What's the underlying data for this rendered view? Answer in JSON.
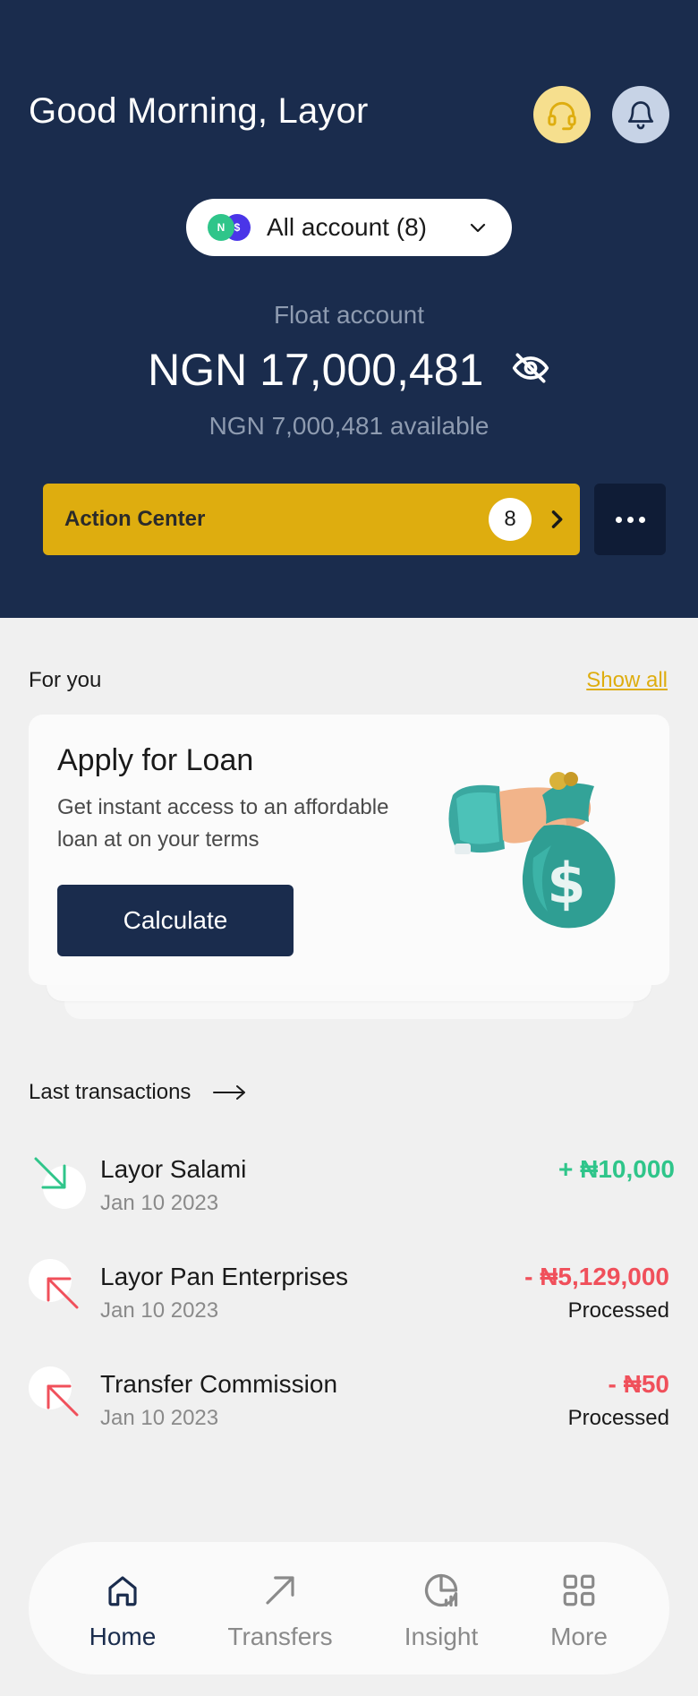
{
  "header": {
    "greeting": "Good Morning, Layor",
    "support_icon": "headset-icon",
    "notification_icon": "bell-icon"
  },
  "account_selector": {
    "label": "All account (8)",
    "flag_1": "N",
    "flag_2": "$"
  },
  "balance": {
    "label": "Float account",
    "amount": "NGN 17,000,481",
    "available": "NGN 7,000,481 available"
  },
  "action_center": {
    "label": "Action Center",
    "count": "8"
  },
  "for_you": {
    "title": "For you",
    "show_all": "Show all",
    "card": {
      "title": "Apply for Loan",
      "description": "Get instant access to an affordable loan at on your terms",
      "button": "Calculate"
    }
  },
  "transactions": {
    "title": "Last transactions",
    "items": [
      {
        "name": "Layor Salami",
        "date": "Jan 10 2023",
        "amount": "+ ₦10,000",
        "status": "",
        "direction": "in"
      },
      {
        "name": "Layor Pan Enterprises",
        "date": "Jan 10 2023",
        "amount": "- ₦5,129,000",
        "status": "Processed",
        "direction": "out"
      },
      {
        "name": "Transfer Commission",
        "date": "Jan 10 2023",
        "amount": "- ₦50",
        "status": "Processed",
        "direction": "out"
      }
    ]
  },
  "nav": {
    "items": [
      {
        "label": "Home",
        "icon": "home-icon",
        "active": true
      },
      {
        "label": "Transfers",
        "icon": "transfer-arrow-icon",
        "active": false
      },
      {
        "label": "Insight",
        "icon": "pie-chart-icon",
        "active": false
      },
      {
        "label": "More",
        "icon": "grid-icon",
        "active": false
      }
    ]
  },
  "colors": {
    "navy": "#1a2c4d",
    "gold": "#dead0f",
    "green": "#2fc58a",
    "red": "#f0505b"
  }
}
